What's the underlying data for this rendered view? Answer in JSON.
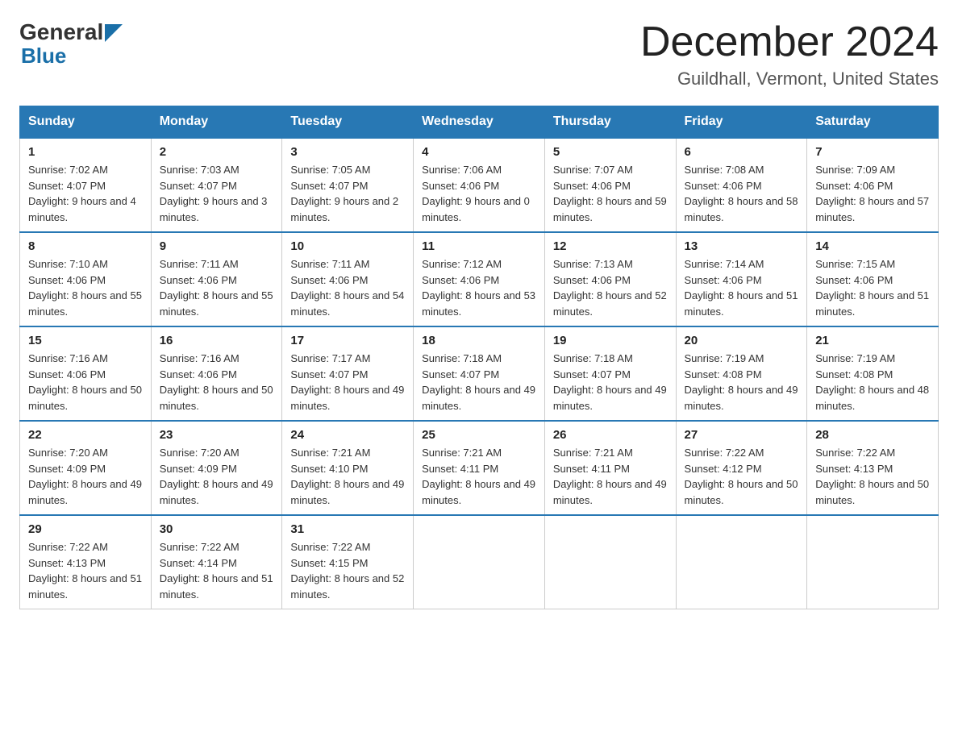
{
  "header": {
    "logo_text_general": "General",
    "logo_text_blue": "Blue",
    "month_title": "December 2024",
    "location": "Guildhall, Vermont, United States"
  },
  "weekdays": [
    "Sunday",
    "Monday",
    "Tuesday",
    "Wednesday",
    "Thursday",
    "Friday",
    "Saturday"
  ],
  "weeks": [
    [
      {
        "day": "1",
        "sunrise": "Sunrise: 7:02 AM",
        "sunset": "Sunset: 4:07 PM",
        "daylight": "Daylight: 9 hours and 4 minutes."
      },
      {
        "day": "2",
        "sunrise": "Sunrise: 7:03 AM",
        "sunset": "Sunset: 4:07 PM",
        "daylight": "Daylight: 9 hours and 3 minutes."
      },
      {
        "day": "3",
        "sunrise": "Sunrise: 7:05 AM",
        "sunset": "Sunset: 4:07 PM",
        "daylight": "Daylight: 9 hours and 2 minutes."
      },
      {
        "day": "4",
        "sunrise": "Sunrise: 7:06 AM",
        "sunset": "Sunset: 4:06 PM",
        "daylight": "Daylight: 9 hours and 0 minutes."
      },
      {
        "day": "5",
        "sunrise": "Sunrise: 7:07 AM",
        "sunset": "Sunset: 4:06 PM",
        "daylight": "Daylight: 8 hours and 59 minutes."
      },
      {
        "day": "6",
        "sunrise": "Sunrise: 7:08 AM",
        "sunset": "Sunset: 4:06 PM",
        "daylight": "Daylight: 8 hours and 58 minutes."
      },
      {
        "day": "7",
        "sunrise": "Sunrise: 7:09 AM",
        "sunset": "Sunset: 4:06 PM",
        "daylight": "Daylight: 8 hours and 57 minutes."
      }
    ],
    [
      {
        "day": "8",
        "sunrise": "Sunrise: 7:10 AM",
        "sunset": "Sunset: 4:06 PM",
        "daylight": "Daylight: 8 hours and 55 minutes."
      },
      {
        "day": "9",
        "sunrise": "Sunrise: 7:11 AM",
        "sunset": "Sunset: 4:06 PM",
        "daylight": "Daylight: 8 hours and 55 minutes."
      },
      {
        "day": "10",
        "sunrise": "Sunrise: 7:11 AM",
        "sunset": "Sunset: 4:06 PM",
        "daylight": "Daylight: 8 hours and 54 minutes."
      },
      {
        "day": "11",
        "sunrise": "Sunrise: 7:12 AM",
        "sunset": "Sunset: 4:06 PM",
        "daylight": "Daylight: 8 hours and 53 minutes."
      },
      {
        "day": "12",
        "sunrise": "Sunrise: 7:13 AM",
        "sunset": "Sunset: 4:06 PM",
        "daylight": "Daylight: 8 hours and 52 minutes."
      },
      {
        "day": "13",
        "sunrise": "Sunrise: 7:14 AM",
        "sunset": "Sunset: 4:06 PM",
        "daylight": "Daylight: 8 hours and 51 minutes."
      },
      {
        "day": "14",
        "sunrise": "Sunrise: 7:15 AM",
        "sunset": "Sunset: 4:06 PM",
        "daylight": "Daylight: 8 hours and 51 minutes."
      }
    ],
    [
      {
        "day": "15",
        "sunrise": "Sunrise: 7:16 AM",
        "sunset": "Sunset: 4:06 PM",
        "daylight": "Daylight: 8 hours and 50 minutes."
      },
      {
        "day": "16",
        "sunrise": "Sunrise: 7:16 AM",
        "sunset": "Sunset: 4:06 PM",
        "daylight": "Daylight: 8 hours and 50 minutes."
      },
      {
        "day": "17",
        "sunrise": "Sunrise: 7:17 AM",
        "sunset": "Sunset: 4:07 PM",
        "daylight": "Daylight: 8 hours and 49 minutes."
      },
      {
        "day": "18",
        "sunrise": "Sunrise: 7:18 AM",
        "sunset": "Sunset: 4:07 PM",
        "daylight": "Daylight: 8 hours and 49 minutes."
      },
      {
        "day": "19",
        "sunrise": "Sunrise: 7:18 AM",
        "sunset": "Sunset: 4:07 PM",
        "daylight": "Daylight: 8 hours and 49 minutes."
      },
      {
        "day": "20",
        "sunrise": "Sunrise: 7:19 AM",
        "sunset": "Sunset: 4:08 PM",
        "daylight": "Daylight: 8 hours and 49 minutes."
      },
      {
        "day": "21",
        "sunrise": "Sunrise: 7:19 AM",
        "sunset": "Sunset: 4:08 PM",
        "daylight": "Daylight: 8 hours and 48 minutes."
      }
    ],
    [
      {
        "day": "22",
        "sunrise": "Sunrise: 7:20 AM",
        "sunset": "Sunset: 4:09 PM",
        "daylight": "Daylight: 8 hours and 49 minutes."
      },
      {
        "day": "23",
        "sunrise": "Sunrise: 7:20 AM",
        "sunset": "Sunset: 4:09 PM",
        "daylight": "Daylight: 8 hours and 49 minutes."
      },
      {
        "day": "24",
        "sunrise": "Sunrise: 7:21 AM",
        "sunset": "Sunset: 4:10 PM",
        "daylight": "Daylight: 8 hours and 49 minutes."
      },
      {
        "day": "25",
        "sunrise": "Sunrise: 7:21 AM",
        "sunset": "Sunset: 4:11 PM",
        "daylight": "Daylight: 8 hours and 49 minutes."
      },
      {
        "day": "26",
        "sunrise": "Sunrise: 7:21 AM",
        "sunset": "Sunset: 4:11 PM",
        "daylight": "Daylight: 8 hours and 49 minutes."
      },
      {
        "day": "27",
        "sunrise": "Sunrise: 7:22 AM",
        "sunset": "Sunset: 4:12 PM",
        "daylight": "Daylight: 8 hours and 50 minutes."
      },
      {
        "day": "28",
        "sunrise": "Sunrise: 7:22 AM",
        "sunset": "Sunset: 4:13 PM",
        "daylight": "Daylight: 8 hours and 50 minutes."
      }
    ],
    [
      {
        "day": "29",
        "sunrise": "Sunrise: 7:22 AM",
        "sunset": "Sunset: 4:13 PM",
        "daylight": "Daylight: 8 hours and 51 minutes."
      },
      {
        "day": "30",
        "sunrise": "Sunrise: 7:22 AM",
        "sunset": "Sunset: 4:14 PM",
        "daylight": "Daylight: 8 hours and 51 minutes."
      },
      {
        "day": "31",
        "sunrise": "Sunrise: 7:22 AM",
        "sunset": "Sunset: 4:15 PM",
        "daylight": "Daylight: 8 hours and 52 minutes."
      },
      null,
      null,
      null,
      null
    ]
  ]
}
